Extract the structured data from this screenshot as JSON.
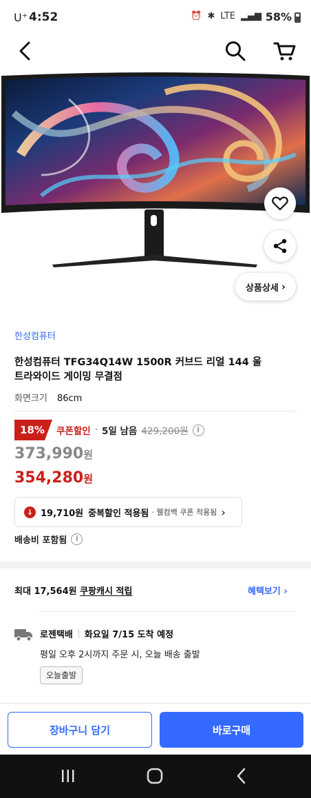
{
  "status_bar": {
    "carrier": "U⁺",
    "time": "4:52",
    "battery": "58%",
    "lte": "LTE"
  },
  "product": {
    "brand": "한성컴퓨터",
    "title": "한성컴퓨터 TFG34Q14W 1500R 커브드 리얼 144 울트라와이드 게이밍 무결점",
    "option_label": "화면크기",
    "option_value": "86cm"
  },
  "hero": {
    "detail_button": "상품상세"
  },
  "pricing": {
    "discount_rate": "18%",
    "coupon_label": "쿠폰할인",
    "days_left": "5일 남음",
    "original_price": "429,200원",
    "sale_price": "373,990",
    "final_price": "354,280",
    "won": "원"
  },
  "extra_discount": {
    "amount": "19,710원",
    "label": "중복할인 적용됨",
    "sub": "· 웰컴백 쿠폰 적용됨"
  },
  "shipping_included": "배송비 포함됨",
  "cashback": {
    "prefix": "최대 17,564원",
    "label": "쿠팡캐시 적립",
    "link": "혜택보기"
  },
  "delivery": {
    "carrier": "로젠택배",
    "eta": "화요일 7/15 도착 예정",
    "cutoff": "평일 오후 2시까지 주문 시, 오늘 배송 출발",
    "badge": "오늘출발"
  },
  "buttons": {
    "cart": "장바구니 담기",
    "buy": "바로구매"
  },
  "colors": {
    "accent": "#346aff",
    "discount": "#cc1f1a"
  }
}
